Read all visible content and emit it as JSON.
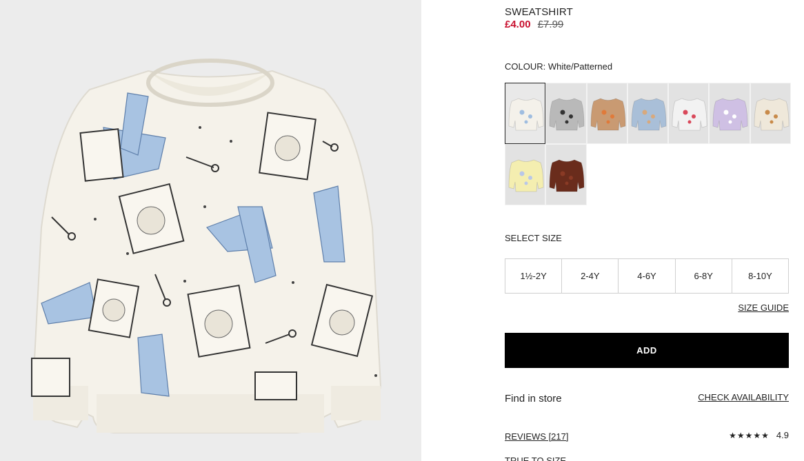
{
  "product": {
    "image_alt": "White patterned sweatshirt with blue bows and cat stamps",
    "title": "SWEATSHIRT",
    "price_sale": "£4.00",
    "price_original": "£7.99",
    "colour_label": "COLOUR:",
    "colour_value": "White/Patterned",
    "swatches": [
      {
        "name": "White/Patterned bows",
        "color": "#f4f1ea",
        "accent": "#9fbde0"
      },
      {
        "name": "Grey/Patterned",
        "color": "#b9b9b9",
        "accent": "#333333"
      },
      {
        "name": "Beige/Fox",
        "color": "#c99a72",
        "accent": "#e07a3a"
      },
      {
        "name": "Light blue/Rabbit",
        "color": "#a9bfd8",
        "accent": "#d8a97d"
      },
      {
        "name": "White/Candy canes",
        "color": "#f2f2f2",
        "accent": "#d9485a"
      },
      {
        "name": "Light purple/Unicorn",
        "color": "#cfc0e4",
        "accent": "#ffffff"
      },
      {
        "name": "Cream/Patterned",
        "color": "#efe8da",
        "accent": "#c88a4a"
      },
      {
        "name": "Light yellow/Cat",
        "color": "#f4eeb0",
        "accent": "#b9c7e8"
      },
      {
        "name": "Dark brown/Teddy",
        "color": "#6a2c1c",
        "accent": "#8a3a25"
      }
    ],
    "size_label": "SELECT SIZE",
    "sizes": [
      "1½-2Y",
      "2-4Y",
      "4-6Y",
      "6-8Y",
      "8-10Y"
    ],
    "size_guide": "SIZE GUIDE",
    "add_label": "ADD",
    "find_in_store": "Find in store",
    "check_availability": "CHECK AVAILABILITY",
    "reviews_label": "REVIEWS [217]",
    "stars": "★★★★★",
    "rating": "4.9",
    "true_to_size": "TRUE TO SIZE"
  }
}
